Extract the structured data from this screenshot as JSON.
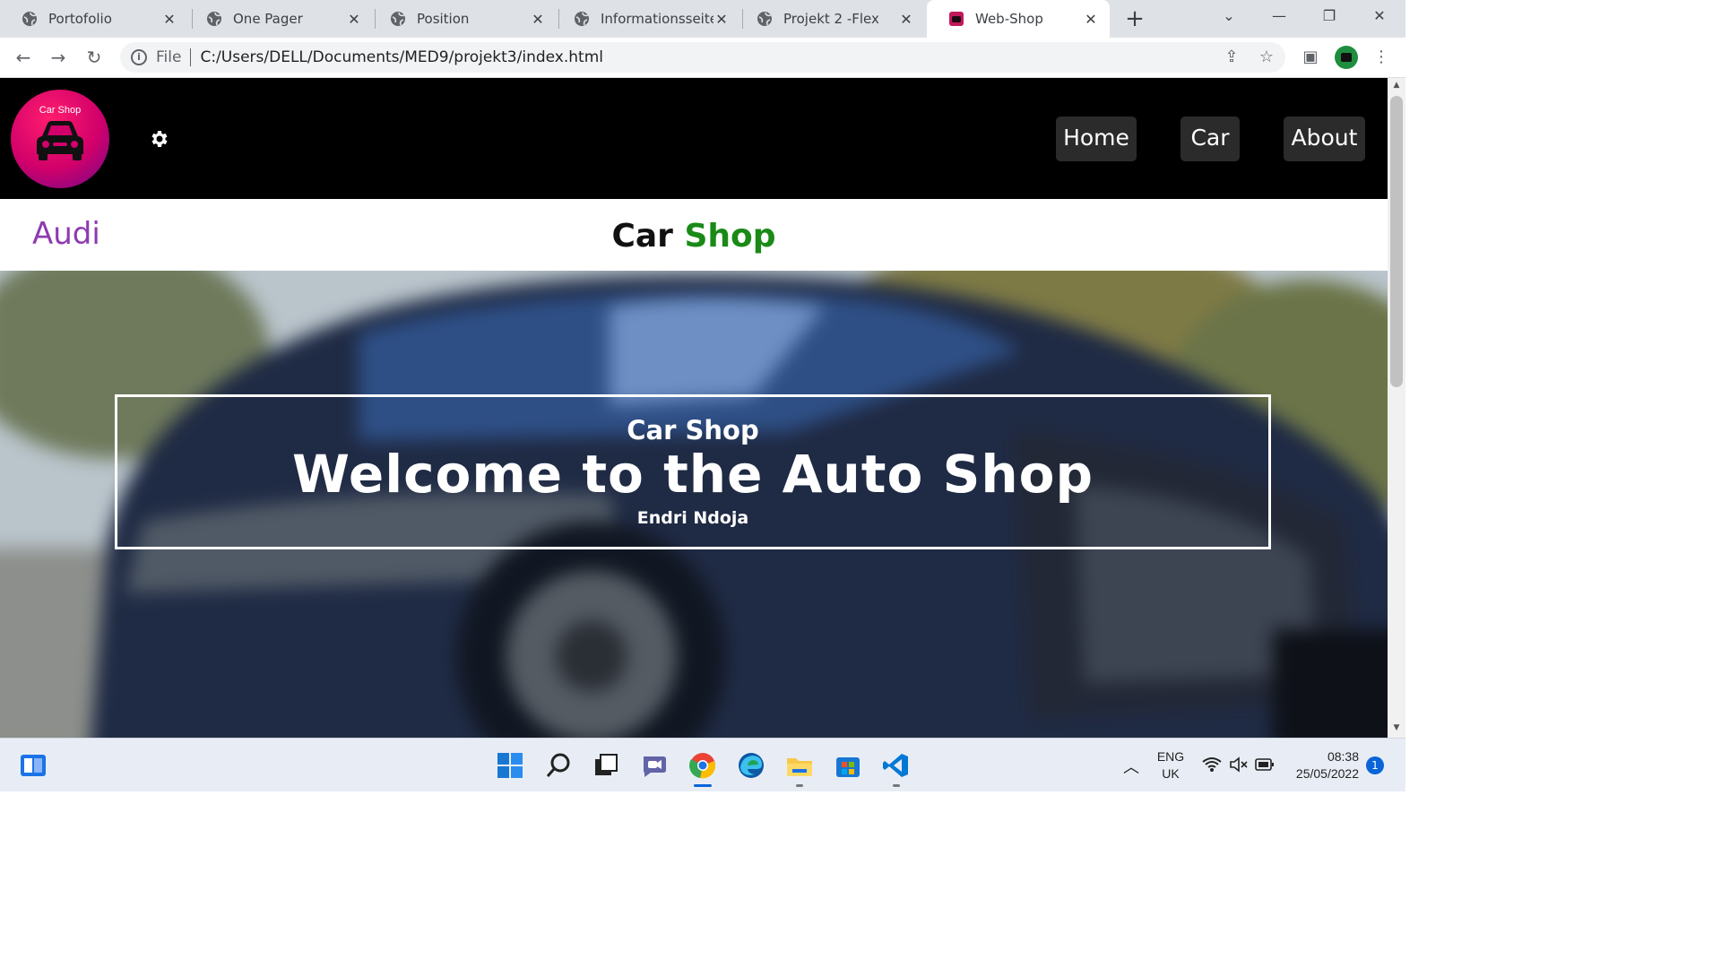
{
  "browser": {
    "tabs": [
      {
        "title": "Portofolio",
        "active": false
      },
      {
        "title": "One Pager",
        "active": false
      },
      {
        "title": "Position",
        "active": false
      },
      {
        "title": "Informationsseite T",
        "active": false
      },
      {
        "title": "Projekt 2 -Flex",
        "active": false
      },
      {
        "title": "Web-Shop",
        "active": true
      }
    ],
    "new_tab": "+",
    "close_glyph": "✕",
    "address": {
      "scheme_label": "File",
      "url": "C:/Users/DELL/Documents/MED9/projekt3/index.html"
    }
  },
  "page": {
    "logo_text": "Car Shop",
    "nav": [
      "Home",
      "Car",
      "About"
    ],
    "brand": "Audi",
    "title_part1": "Car",
    "title_part2": "Shop",
    "hero": {
      "subtitle": "Car Shop",
      "title": "Welcome to the Auto Shop",
      "author": "Endri Ndoja"
    },
    "colors": {
      "header_bg": "#000000",
      "brand_purple": "#8e3ab0",
      "title_green": "#1a8a17",
      "logo_gradient_start": "#ff1d6e",
      "logo_gradient_end": "#6a0a8e"
    }
  },
  "taskbar": {
    "language_line1": "ENG",
    "language_line2": "UK",
    "time": "08:38",
    "date": "25/05/2022",
    "notification_count": "1",
    "apps": [
      "start-icon",
      "search-icon",
      "task-view-icon",
      "teams-chat-icon",
      "chrome-icon",
      "edge-icon",
      "file-explorer-icon",
      "store-icon",
      "vscode-icon"
    ]
  }
}
